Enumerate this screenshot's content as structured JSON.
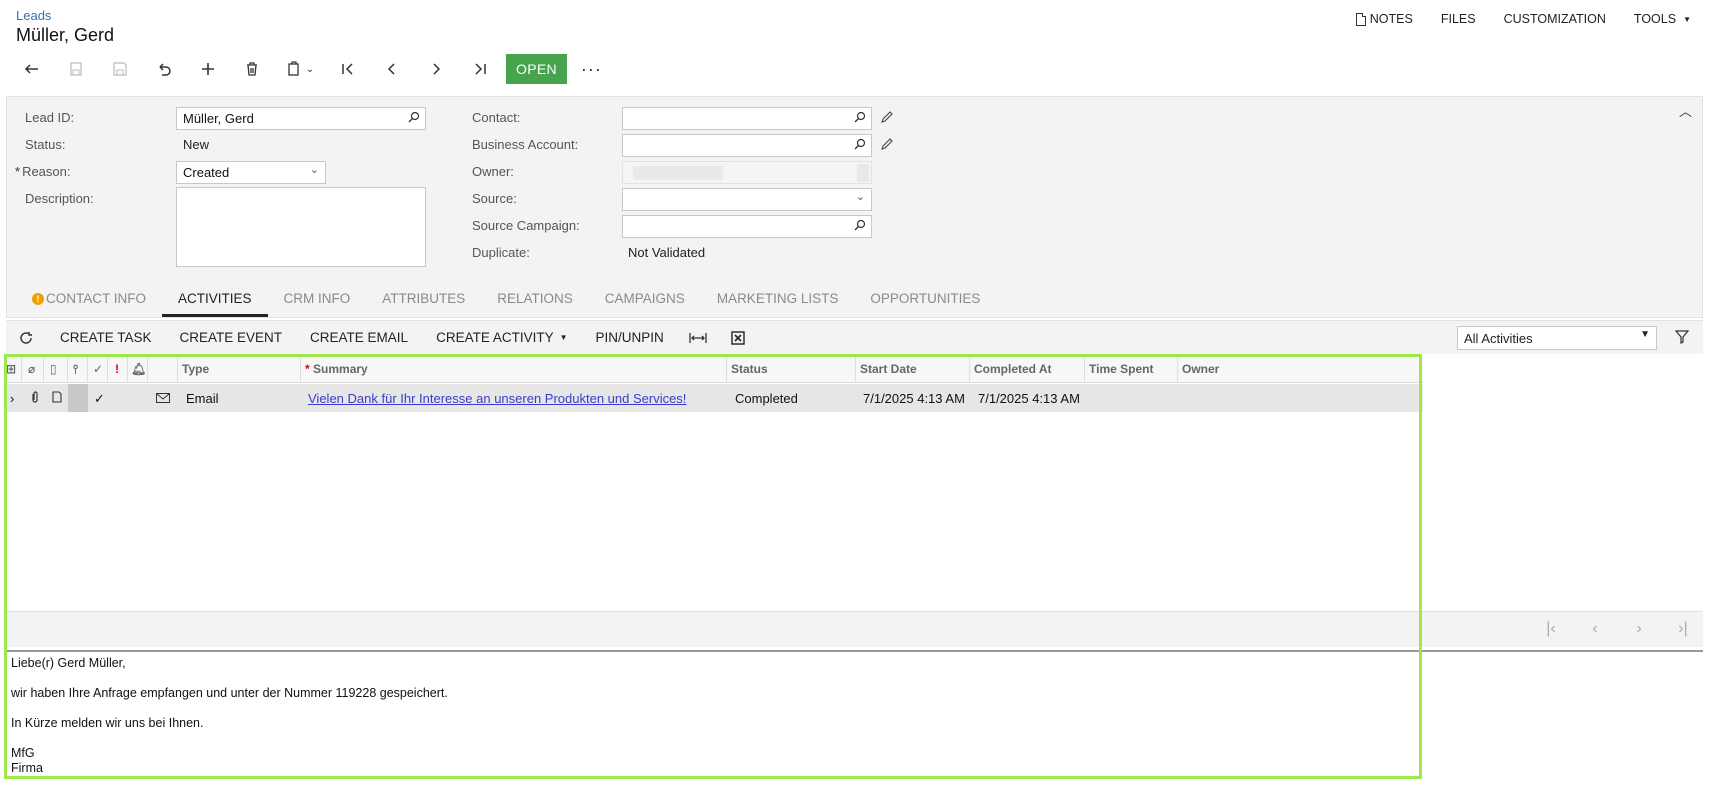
{
  "header": {
    "breadcrumb": "Leads",
    "title": "Müller, Gerd",
    "links": {
      "notes": "NOTES",
      "files": "FILES",
      "customization": "CUSTOMIZATION",
      "tools": "TOOLS"
    }
  },
  "toolbar": {
    "open_label": "OPEN",
    "more_label": "···"
  },
  "form": {
    "lead_id_label": "Lead ID:",
    "lead_id_value": "Müller, Gerd",
    "status_label": "Status:",
    "status_value": "New",
    "reason_label": "Reason:",
    "reason_value": "Created",
    "description_label": "Description:",
    "contact_label": "Contact:",
    "business_account_label": "Business Account:",
    "owner_label": "Owner:",
    "source_label": "Source:",
    "source_campaign_label": "Source Campaign:",
    "duplicate_label": "Duplicate:",
    "duplicate_value": "Not Validated"
  },
  "tabs": [
    {
      "label": "CONTACT INFO"
    },
    {
      "label": "ACTIVITIES"
    },
    {
      "label": "CRM INFO"
    },
    {
      "label": "ATTRIBUTES"
    },
    {
      "label": "RELATIONS"
    },
    {
      "label": "CAMPAIGNS"
    },
    {
      "label": "MARKETING LISTS"
    },
    {
      "label": "OPPORTUNITIES"
    }
  ],
  "grid_toolbar": {
    "create_task": "CREATE TASK",
    "create_event": "CREATE EVENT",
    "create_email": "CREATE EMAIL",
    "create_activity": "CREATE ACTIVITY",
    "pin_unpin": "PIN/UNPIN",
    "filter_value": "All Activities"
  },
  "grid": {
    "columns": {
      "type": "Type",
      "summary": "Summary",
      "status": "Status",
      "start_date": "Start Date",
      "completed_at": "Completed At",
      "time_spent": "Time Spent",
      "owner": "Owner"
    },
    "rows": [
      {
        "type": "Email",
        "summary": "Vielen Dank für Ihr Interesse an unseren Produkten und Services!",
        "status": "Completed",
        "start_date": "7/1/2025 4:13 AM",
        "completed_at": "7/1/2025 4:13 AM",
        "time_spent": "",
        "owner": ""
      }
    ]
  },
  "preview": {
    "greeting": "Liebe(r) Gerd Müller,",
    "line1": "wir haben Ihre Anfrage empfangen und unter der Nummer 119228 gespeichert.",
    "line2": "In Kürze melden wir uns bei Ihnen.",
    "closing": "MfG",
    "company": "Firma"
  },
  "colors": {
    "accent_green": "#47a34e",
    "highlight": "#9ee84a",
    "link": "#3b6fb6"
  }
}
